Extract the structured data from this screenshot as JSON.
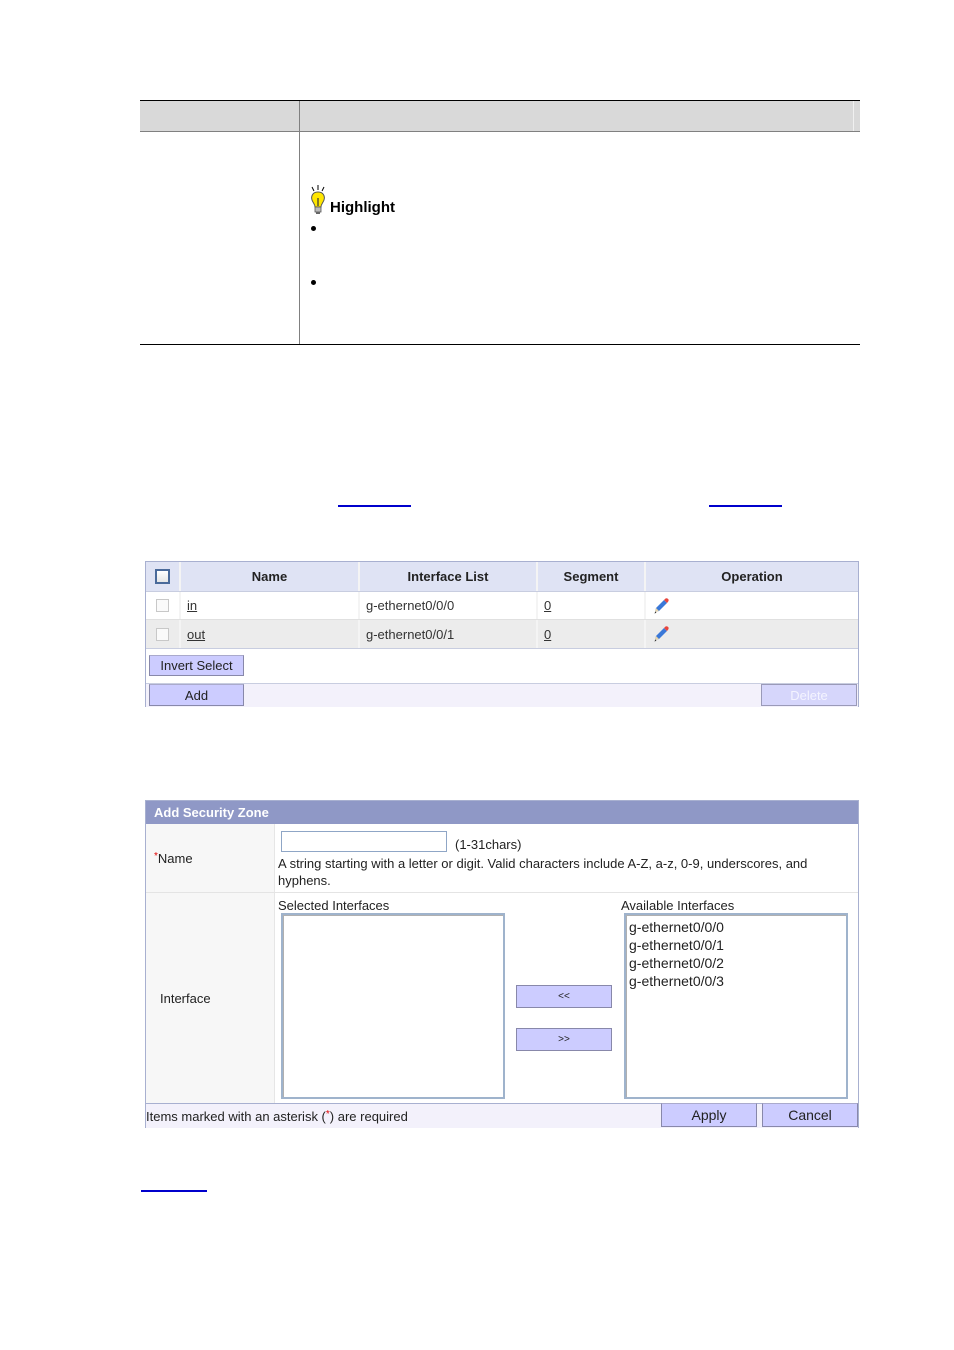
{
  "doc_table": {
    "header_cells": [
      "",
      ""
    ],
    "note_title": "Highlight",
    "note_icon": "lightbulb-icon",
    "bullets": 2
  },
  "zone_list": {
    "columns": [
      "Name",
      "Interface List",
      "Segment",
      "Operation"
    ],
    "rows": [
      {
        "name": "in",
        "interfaces": "g-ethernet0/0/0",
        "segment": "0",
        "operation_icon": "edit-pencil-icon"
      },
      {
        "name": "out",
        "interfaces": "g-ethernet0/0/1",
        "segment": "0",
        "operation_icon": "edit-pencil-icon"
      }
    ],
    "invert_select_label": "Invert Select",
    "add_label": "Add",
    "delete_label": "Delete"
  },
  "add_zone_form": {
    "title": "Add Security Zone",
    "name_label": "Name",
    "required_mark": "*",
    "name_value": "",
    "name_hint": "(1-31chars)",
    "name_desc_line1": "A string starting with a letter or digit. Valid characters include A-Z, a-z, 0-9, underscores, and",
    "name_desc_line2": "hyphens.",
    "interface_label": "Interface",
    "selected_label": "Selected Interfaces",
    "available_label": "Available Interfaces",
    "selected_interfaces": [],
    "available_interfaces": [
      "g-ethernet0/0/0",
      "g-ethernet0/0/1",
      "g-ethernet0/0/2",
      "g-ethernet0/0/3"
    ],
    "move_left_label": "<<",
    "move_right_label": ">>",
    "footer_note_prefix": "Items marked with an asterisk (",
    "footer_note_suffix": ") are required",
    "apply_label": "Apply",
    "cancel_label": "Cancel"
  },
  "colors": {
    "link": "#0000cc",
    "button_bg": "#ccccff",
    "form_title_bg": "#8f98c6",
    "table_header_bg": "#dfe3f4"
  }
}
